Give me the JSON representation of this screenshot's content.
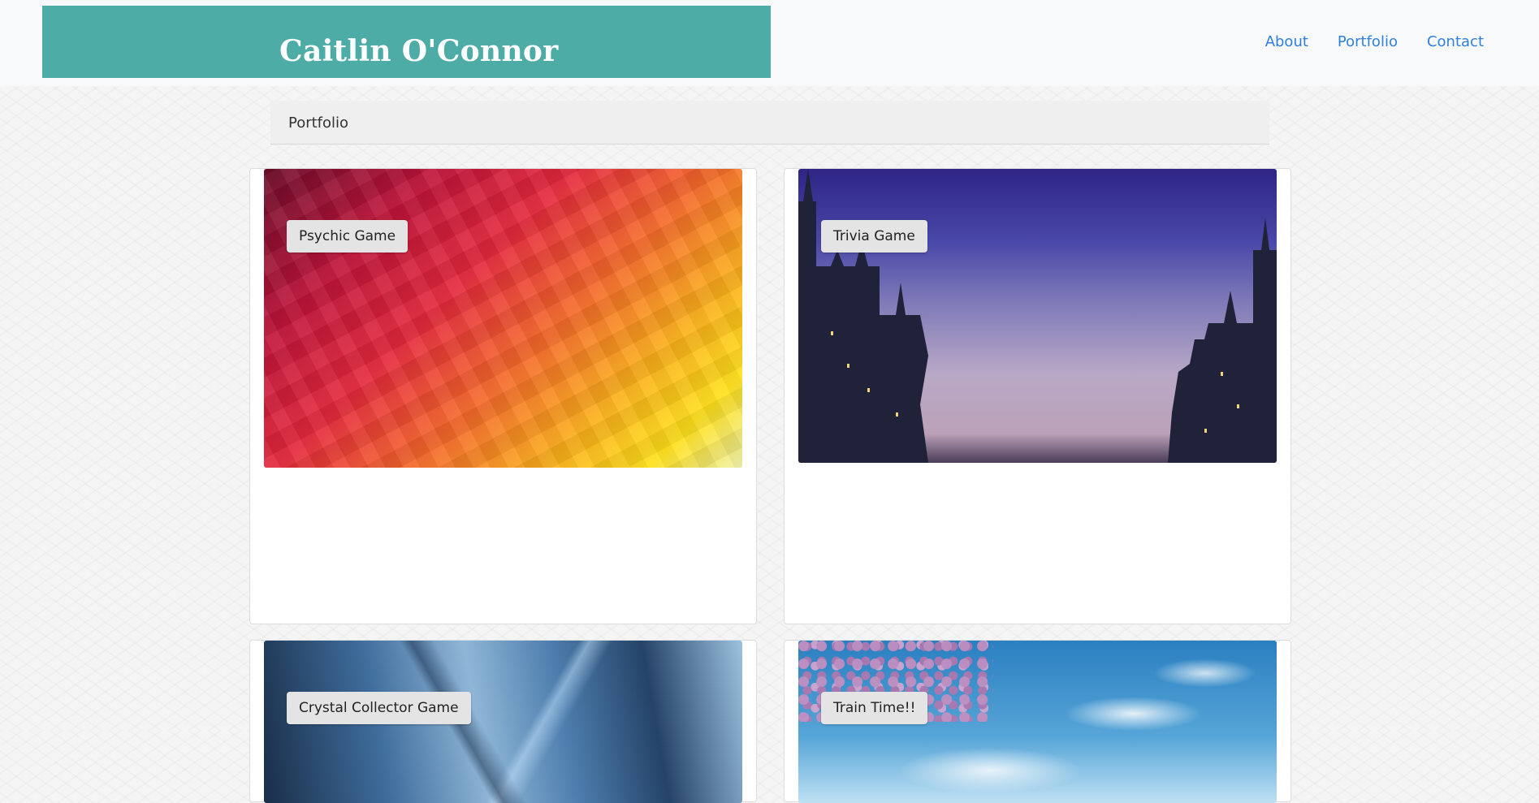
{
  "header": {
    "brand": "Caitlin O'Connor",
    "nav": [
      {
        "label": "About"
      },
      {
        "label": "Portfolio"
      },
      {
        "label": "Contact"
      }
    ]
  },
  "breadcrumb": {
    "label": "Portfolio"
  },
  "projects": [
    {
      "title": "Psychic Game"
    },
    {
      "title": "Trivia Game"
    },
    {
      "title": "Crystal Collector Game"
    },
    {
      "title": "Train Time!!"
    }
  ],
  "colors": {
    "brand_bg": "#4eaca7",
    "link": "#2f7fde"
  }
}
